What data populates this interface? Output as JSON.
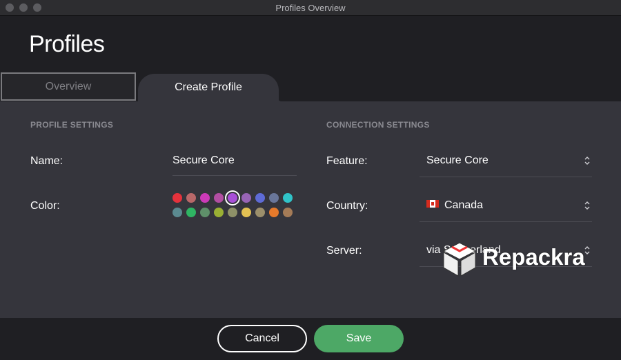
{
  "window": {
    "title": "Profiles Overview"
  },
  "header": {
    "title": "Profiles"
  },
  "tabs": [
    {
      "label": "Overview",
      "active": false
    },
    {
      "label": "Create Profile",
      "active": true
    }
  ],
  "profile_settings": {
    "title": "PROFILE SETTINGS",
    "name_label": "Name:",
    "name_value": "Secure Core",
    "color_label": "Color:",
    "colors_row1": [
      "#e5323c",
      "#b96869",
      "#cc3ab8",
      "#b24ea2",
      "#a84fd7",
      "#9864b6",
      "#5e6bd6",
      "#69769a",
      "#30c3c8"
    ],
    "colors_row2": [
      "#5b8a90",
      "#2fb563",
      "#5f906a",
      "#9ab034",
      "#8e9168",
      "#e3c153",
      "#9c8f6b",
      "#e67a2b",
      "#a47b57"
    ],
    "selected_color": "#a84fd7"
  },
  "connection_settings": {
    "title": "CONNECTION SETTINGS",
    "feature_label": "Feature:",
    "feature_value": "Secure Core",
    "country_label": "Country:",
    "country_value": "Canada",
    "country_flag": "canada-flag-icon",
    "server_label": "Server:",
    "server_value": "via Switzerland"
  },
  "footer": {
    "cancel_label": "Cancel",
    "save_label": "Save",
    "save_color": "#4da866"
  },
  "watermark": {
    "text": "Repackra"
  }
}
